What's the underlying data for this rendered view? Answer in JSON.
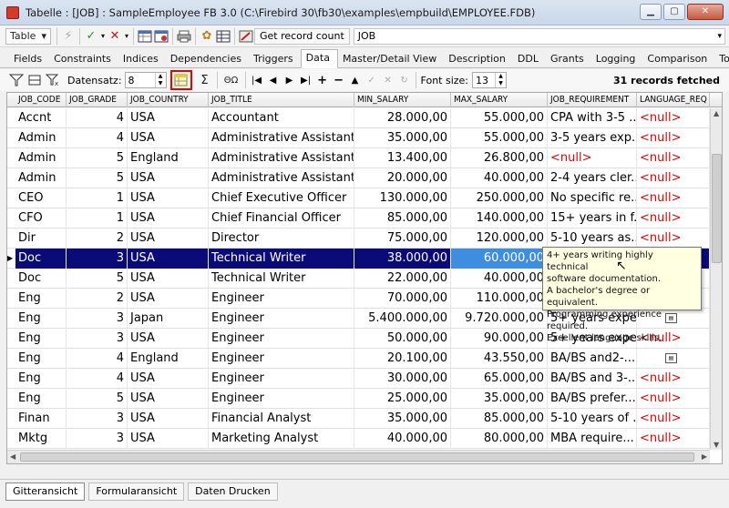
{
  "window": {
    "title": "Tabelle : [JOB] : SampleEmployee FB 3.0 (C:\\Firebird 30\\fb30\\examples\\empbuild\\EMPLOYEE.FDB)",
    "min_label": "▁",
    "max_label": "▢",
    "close_label": "✕"
  },
  "toolbar": {
    "table_dropdown": "Table",
    "get_record_count": "Get record count",
    "object_name": "JOB"
  },
  "tabs": [
    "Fields",
    "Constraints",
    "Indices",
    "Dependencies",
    "Triggers",
    "Data",
    "Master/Detail View",
    "Description",
    "DDL",
    "Grants",
    "Logging",
    "Comparison",
    "To-do"
  ],
  "active_tab": "Data",
  "gridbar": {
    "datensatz_label": "Datensatz:",
    "datensatz_value": "8",
    "font_size_label": "Font size:",
    "font_size_value": "13",
    "records_fetched": "31 records fetched",
    "sigma": "Σ",
    "omega": "ΘΩ"
  },
  "columns": [
    "JOB_CODE",
    "JOB_GRADE",
    "JOB_COUNTRY",
    "JOB_TITLE",
    "MIN_SALARY",
    "MAX_SALARY",
    "JOB_REQUIREMENT",
    "LANGUAGE_REQ"
  ],
  "rows": [
    {
      "code": "Accnt",
      "grade": "4",
      "country": "USA",
      "title": "Accountant",
      "min": "28.000,00",
      "max": "55.000,00",
      "req": "CPA with 3-5 ...",
      "lang": "<null>",
      "req_null": false
    },
    {
      "code": "Admin",
      "grade": "4",
      "country": "USA",
      "title": "Administrative Assistant",
      "min": "35.000,00",
      "max": "55.000,00",
      "req": "3-5 years exp...",
      "lang": "<null>",
      "req_null": false
    },
    {
      "code": "Admin",
      "grade": "5",
      "country": "England",
      "title": "Administrative Assistant",
      "min": "13.400,00",
      "max": "26.800,00",
      "req": "<null>",
      "lang": "<null>",
      "req_null": true
    },
    {
      "code": "Admin",
      "grade": "5",
      "country": "USA",
      "title": "Administrative Assistant",
      "min": "20.000,00",
      "max": "40.000,00",
      "req": "2-4 years cler...",
      "lang": "<null>",
      "req_null": false
    },
    {
      "code": "CEO",
      "grade": "1",
      "country": "USA",
      "title": "Chief Executive Officer",
      "min": "130.000,00",
      "max": "250.000,00",
      "req": "No specific re...",
      "lang": "<null>",
      "req_null": false
    },
    {
      "code": "CFO",
      "grade": "1",
      "country": "USA",
      "title": "Chief Financial Officer",
      "min": "85.000,00",
      "max": "140.000,00",
      "req": "15+ years in f...",
      "lang": "<null>",
      "req_null": false
    },
    {
      "code": "Dir",
      "grade": "2",
      "country": "USA",
      "title": "Director",
      "min": "75.000,00",
      "max": "120.000,00",
      "req": "5-10 years as...",
      "lang": "<null>",
      "req_null": false
    },
    {
      "code": "Doc",
      "grade": "3",
      "country": "USA",
      "title": "Technical Writer",
      "min": "38.000,00",
      "max": "60.000,00",
      "req": "",
      "lang": "",
      "req_null": false,
      "selected": true
    },
    {
      "code": "Doc",
      "grade": "5",
      "country": "USA",
      "title": "Technical Writer",
      "min": "22.000,00",
      "max": "40.000,00",
      "req": "",
      "lang": "",
      "req_null": false
    },
    {
      "code": "Eng",
      "grade": "2",
      "country": "USA",
      "title": "Engineer",
      "min": "70.000,00",
      "max": "110.000,00",
      "req": "",
      "lang": "",
      "req_null": false
    },
    {
      "code": "Eng",
      "grade": "3",
      "country": "Japan",
      "title": "Engineer",
      "min": "5.400.000,00",
      "max": "9.720.000,00",
      "req": "5+ years expe...",
      "lang": "",
      "req_null": false,
      "memo": true
    },
    {
      "code": "Eng",
      "grade": "3",
      "country": "USA",
      "title": "Engineer",
      "min": "50.000,00",
      "max": "90.000,00",
      "req": "5+ years expe...",
      "lang": "<null>",
      "req_null": false
    },
    {
      "code": "Eng",
      "grade": "4",
      "country": "England",
      "title": "Engineer",
      "min": "20.100,00",
      "max": "43.550,00",
      "req": "BA/BS and2-...",
      "lang": "",
      "req_null": false,
      "memo": true
    },
    {
      "code": "Eng",
      "grade": "4",
      "country": "USA",
      "title": "Engineer",
      "min": "30.000,00",
      "max": "65.000,00",
      "req": "BA/BS and 3-...",
      "lang": "<null>",
      "req_null": false
    },
    {
      "code": "Eng",
      "grade": "5",
      "country": "USA",
      "title": "Engineer",
      "min": "25.000,00",
      "max": "35.000,00",
      "req": "BA/BS prefer...",
      "lang": "<null>",
      "req_null": false
    },
    {
      "code": "Finan",
      "grade": "3",
      "country": "USA",
      "title": "Financial Analyst",
      "min": "35.000,00",
      "max": "85.000,00",
      "req": "5-10 years of ...",
      "lang": "<null>",
      "req_null": false
    },
    {
      "code": "Mktg",
      "grade": "3",
      "country": "USA",
      "title": "Marketing Analyst",
      "min": "40.000,00",
      "max": "80.000,00",
      "req": "MBA require...",
      "lang": "<null>",
      "req_null": false
    }
  ],
  "tooltip": {
    "lines": [
      "4+ years writing highly technical",
      "software documentation.",
      "A bachelor's degree or equivalent.",
      "Programming experience required.",
      "Excellent language skills."
    ]
  },
  "bottom_tabs": [
    "Gitteransicht",
    "Formularansicht",
    "Daten Drucken"
  ],
  "active_bottom_tab": "Gitteransicht"
}
